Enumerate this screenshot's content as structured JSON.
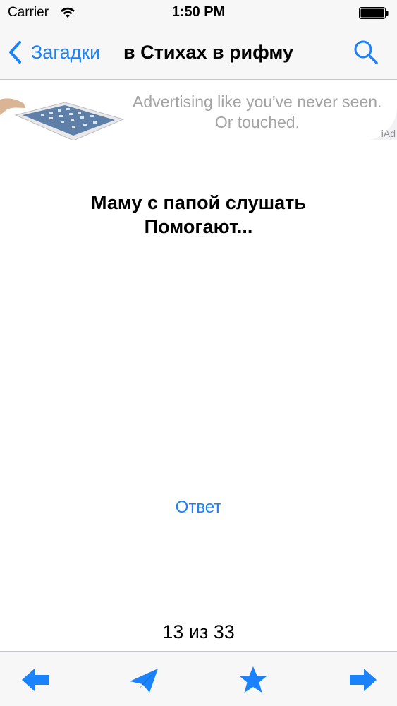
{
  "status_bar": {
    "carrier": "Carrier",
    "time": "1:50 PM",
    "wifi_icon": "wifi-icon",
    "battery_icon": "battery-full-icon"
  },
  "nav": {
    "back_label": "Загадки",
    "title": "в Стихах в рифму",
    "back_icon": "chevron-left-icon",
    "search_icon": "search-icon"
  },
  "ad": {
    "line1": "Advertising like you've never seen.",
    "line2": "Or touched.",
    "tag": "iAd",
    "image": "ipad-image"
  },
  "riddle": {
    "line1": "Маму с папой слушать",
    "line2": "Помогают..."
  },
  "answer_label": "Ответ",
  "counter": "13 из 33",
  "toolbar": {
    "prev_icon": "arrow-left-icon",
    "share_icon": "paper-plane-icon",
    "favorite_icon": "star-icon",
    "next_icon": "arrow-right-icon"
  },
  "colors": {
    "accent": "#1a82fb",
    "bar_background": "#f7f7f8",
    "ad_text": "#a4a4a4"
  }
}
